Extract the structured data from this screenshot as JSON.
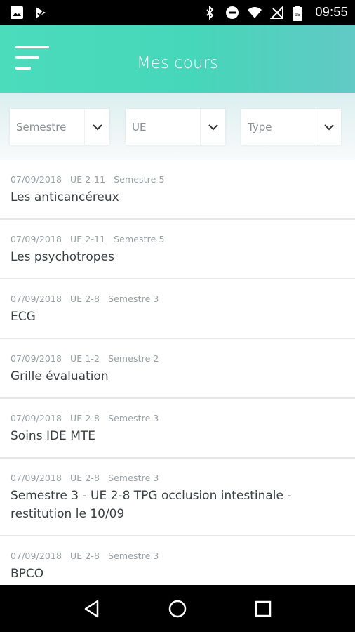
{
  "status_bar": {
    "time": "09:55",
    "battery_level": "95",
    "icons": [
      "image-icon",
      "download-check-icon",
      "bluetooth-icon",
      "do-not-disturb-icon",
      "wifi-icon",
      "no-signal-icon",
      "battery-icon"
    ]
  },
  "app_bar": {
    "title": "Mes cours",
    "menu_icon": "hamburger-menu-icon"
  },
  "filters": [
    {
      "label": "Semestre",
      "icon": "chevron-down-icon"
    },
    {
      "label": "UE",
      "icon": "chevron-down-icon"
    },
    {
      "label": "Type",
      "icon": "chevron-down-icon"
    }
  ],
  "courses": [
    {
      "date": "07/09/2018",
      "ue": "UE 2-11",
      "semestre": "Semestre 5",
      "title": "Les anticancéreux"
    },
    {
      "date": "07/09/2018",
      "ue": "UE 2-11",
      "semestre": "Semestre 5",
      "title": "Les psychotropes"
    },
    {
      "date": "07/09/2018",
      "ue": "UE 2-8",
      "semestre": "Semestre 3",
      "title": "ECG"
    },
    {
      "date": "07/09/2018",
      "ue": "UE 1-2",
      "semestre": "Semestre 2",
      "title": "Grille évaluation"
    },
    {
      "date": "07/09/2018",
      "ue": "UE 2-8",
      "semestre": "Semestre 3",
      "title": "Soins IDE MTE"
    },
    {
      "date": "07/09/2018",
      "ue": "UE 2-8",
      "semestre": "Semestre 3",
      "title": "Semestre 3 - UE 2-8 TPG occlusion intestinale - restitution le 10/09"
    },
    {
      "date": "07/09/2018",
      "ue": "UE 2-8",
      "semestre": "Semestre 3",
      "title": "BPCO"
    }
  ],
  "nav_bar": {
    "icons": [
      "back-triangle-icon",
      "home-circle-icon",
      "recents-square-icon"
    ]
  },
  "colors": {
    "accent": "#4bdcbc",
    "text_primary": "#3b3f42",
    "text_secondary": "#9aa0a4"
  }
}
